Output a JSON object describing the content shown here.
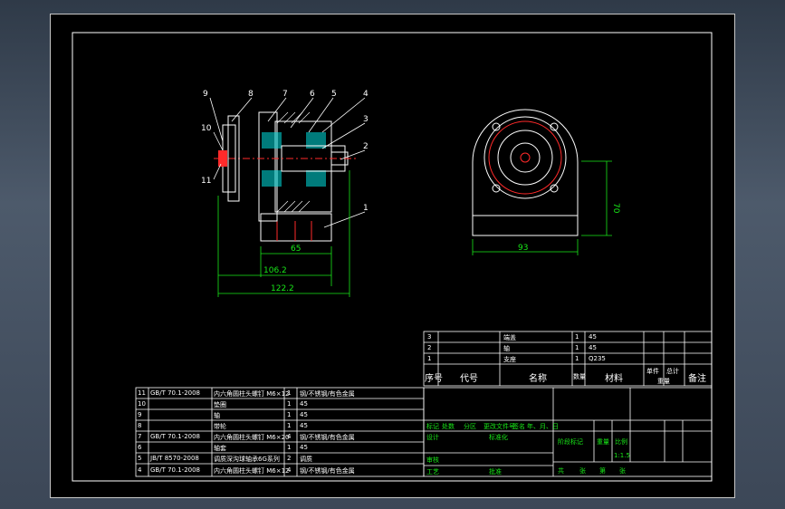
{
  "colors": {
    "background": "#000000",
    "frame": "#ffffff",
    "section_hatch": "#00e0e0",
    "dim": "#18e818",
    "part_red": "#ff2a2a"
  },
  "balloons": [
    "9",
    "8",
    "7",
    "6",
    "5",
    "4",
    "3",
    "2",
    "1",
    "10",
    "11"
  ],
  "dims": {
    "d65": "65",
    "d106": "106.2",
    "d122": "122.2",
    "d93": "93",
    "d70": "70"
  },
  "bom_top": {
    "rows": [
      {
        "no": "3",
        "name": "端盖",
        "qty": "1",
        "mat": "45"
      },
      {
        "no": "2",
        "name": "轴",
        "qty": "1",
        "mat": "45"
      },
      {
        "no": "1",
        "name": "支座",
        "qty": "1",
        "mat": "Q235"
      }
    ],
    "header": {
      "no": "序号",
      "code": "代号",
      "name": "名称",
      "qty": "数量",
      "mat": "材料",
      "single": "单件",
      "total": "总计",
      "weight": "重量",
      "remark": "备注"
    }
  },
  "bom_left": [
    {
      "no": "11",
      "std": "GB/T 70.1-2008",
      "name": "内六角圆柱头螺钉 M6×12",
      "qty": "1",
      "mat": "钢/不锈钢/有色金属"
    },
    {
      "no": "10",
      "std": "",
      "name": "垫圈",
      "qty": "1",
      "mat": "45"
    },
    {
      "no": "9",
      "std": "",
      "name": "轴",
      "qty": "1",
      "mat": "45"
    },
    {
      "no": "8",
      "std": "",
      "name": "带轮",
      "qty": "1",
      "mat": "45"
    },
    {
      "no": "7",
      "std": "GB/T 70.1-2008",
      "name": "内六角圆柱头螺钉 M6×20",
      "qty": "4",
      "mat": "钢/不锈钢/有色金属"
    },
    {
      "no": "6",
      "std": "",
      "name": "轴套",
      "qty": "1",
      "mat": "45"
    },
    {
      "no": "5",
      "std": "JB/T 8570-2008",
      "name": "调质深沟球轴承6G系列",
      "qty": "2",
      "mat": "调质"
    },
    {
      "no": "4",
      "std": "GB/T 70.1-2008",
      "name": "内六角圆柱头螺钉 M6×12",
      "qty": "4",
      "mat": "钢/不锈钢/有色金属"
    }
  ],
  "title_block": {
    "mark": "标记",
    "count": "处数",
    "zone": "分区",
    "change_doc": "更改文件号",
    "sign": "签名",
    "date": "年、月、日",
    "design": "设计",
    "standard": "标准化",
    "review": "审核",
    "process": "工艺",
    "approve": "批准",
    "stage": "阶段标记",
    "weight": "重量",
    "scale": "比例",
    "scale_val": "1:1.5",
    "sheets": "共",
    "sheet_of": "张",
    "page": "第",
    "page_of": "张"
  }
}
